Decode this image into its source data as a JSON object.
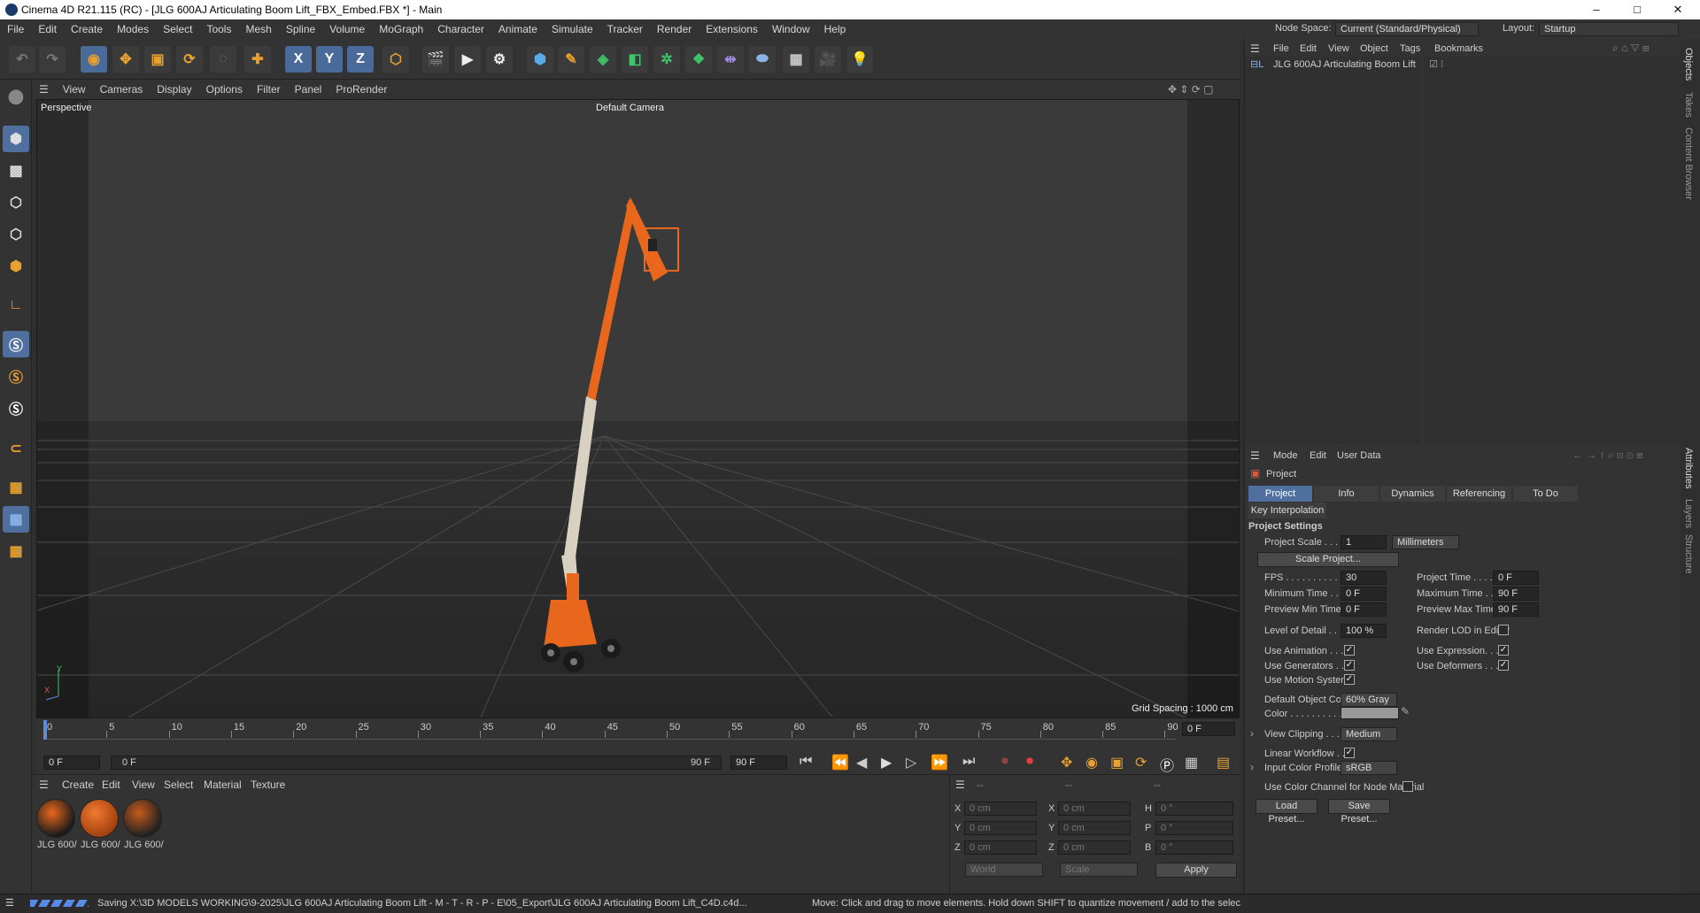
{
  "window": {
    "title": "Cinema 4D R21.115 (RC) - [JLG 600AJ Articulating Boom Lift_FBX_Embed.FBX *] - Main",
    "controls": [
      "–",
      "□",
      "✕"
    ]
  },
  "menu": [
    "File",
    "Edit",
    "Create",
    "Modes",
    "Select",
    "Tools",
    "Mesh",
    "Spline",
    "Volume",
    "MoGraph",
    "Character",
    "Animate",
    "Simulate",
    "Tracker",
    "Render",
    "Extensions",
    "Window",
    "Help"
  ],
  "nodespace": {
    "label": "Node Space:",
    "value": "Current (Standard/Physical)"
  },
  "layout": {
    "label": "Layout:",
    "value": "Startup"
  },
  "toolbar": {
    "x": "X",
    "y": "Y",
    "z": "Z"
  },
  "viewport": {
    "menu": [
      "View",
      "Cameras",
      "Display",
      "Options",
      "Filter",
      "Panel",
      "ProRender"
    ],
    "name": "Perspective",
    "camera": "Default Camera",
    "grid": "Grid Spacing : 1000 cm",
    "axis_y": "Y",
    "axis_x": "X",
    "axis_z": "Z"
  },
  "timeline": {
    "ticks": [
      "0",
      "5",
      "10",
      "15",
      "20",
      "25",
      "30",
      "35",
      "40",
      "45",
      "50",
      "55",
      "60",
      "65",
      "70",
      "75",
      "80",
      "85",
      "90"
    ],
    "frame_end": "0 F",
    "start": "0 F",
    "range_start": "0 F",
    "range_end": "90 F",
    "end": "90 F"
  },
  "materials": {
    "menu": [
      "Create",
      "Edit",
      "View",
      "Select",
      "Material",
      "Texture"
    ],
    "items": [
      "JLG 600/",
      "JLG 600/",
      "JLG 600/"
    ]
  },
  "coords": {
    "rows": [
      {
        "a": "X",
        "av": "0 cm",
        "b": "X",
        "bv": "0 cm",
        "c": "H",
        "cv": "0 °"
      },
      {
        "a": "Y",
        "av": "0 cm",
        "b": "Y",
        "bv": "0 cm",
        "c": "P",
        "cv": "0 °"
      },
      {
        "a": "Z",
        "av": "0 cm",
        "b": "Z",
        "bv": "0 cm",
        "c": "B",
        "cv": "0 °"
      }
    ],
    "world": "World",
    "scale": "Scale",
    "apply": "Apply",
    "dashes": "--"
  },
  "objects": {
    "menu": [
      "File",
      "Edit",
      "View",
      "Object",
      "Tags",
      "Bookmarks"
    ],
    "item": "JLG 600AJ Articulating Boom Lift"
  },
  "attributes": {
    "menu": [
      "Mode",
      "Edit",
      "User Data"
    ],
    "title": "Project",
    "tabs": [
      "Project Settings",
      "Info",
      "Dynamics",
      "Referencing",
      "To Do"
    ],
    "tab2": "Key Interpolation",
    "section": "Project Settings",
    "project_scale": {
      "label": "Project Scale . . . . .",
      "value": "1",
      "unit": "Millimeters"
    },
    "scale_btn": "Scale Project...",
    "fps": {
      "label": "FPS . . . . . . . . . . . . .",
      "value": "30"
    },
    "project_time": {
      "label": "Project Time . . . . .",
      "value": "0 F"
    },
    "min_time": {
      "label": "Minimum Time . . . .",
      "value": "0 F"
    },
    "max_time": {
      "label": "Maximum Time . . .",
      "value": "90 F"
    },
    "prev_min": {
      "label": "Preview Min Time . .",
      "value": "0 F"
    },
    "prev_max": {
      "label": "Preview Max Time . .",
      "value": "90 F"
    },
    "lod": {
      "label": "Level of Detail . . . .",
      "value": "100 %"
    },
    "render_lod": "Render LOD in Editor",
    "use_anim": "Use Animation . . . .",
    "use_expr": "Use Expression. . . .",
    "use_gen": "Use Generators . . .",
    "use_def": "Use Deformers . . . .",
    "use_motion": "Use Motion System",
    "def_color": {
      "label": "Default Object Color",
      "value": "60% Gray"
    },
    "color": "Color . . . . . . . . . . .",
    "clipping": {
      "label": "View Clipping . . . . .",
      "value": "Medium"
    },
    "linear": "Linear Workflow . . .",
    "input_profile": {
      "label": "Input Color Profile",
      "value": "sRGB"
    },
    "use_color_channel": "Use Color Channel for Node Material",
    "load": "Load Preset...",
    "save": "Save Preset..."
  },
  "side_tabs": [
    "Objects",
    "Takes",
    "Content Browser",
    "Attributes",
    "Layers",
    "Structure"
  ],
  "status": {
    "left": "Saving X:\\3D MODELS WORKING\\9-2025\\JLG 600AJ Articulating Boom Lift - M - T - R - P - E\\05_Export\\JLG 600AJ Articulating Boom Lift_C4D.c4d...",
    "right": "Move: Click and drag to move elements. Hold down SHIFT to quantize movement / add to the selec"
  },
  "colors": {
    "accent": "#4f6f9f",
    "orange": "#e8671c"
  }
}
